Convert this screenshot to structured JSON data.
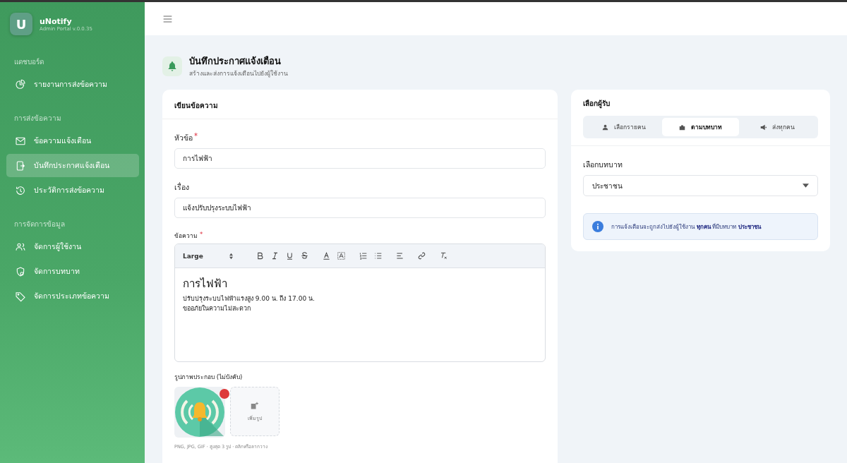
{
  "sidebar": {
    "app_name": "uNotify",
    "version": "Admin Portal v.0.0.35",
    "logo_letter": "U",
    "sections": [
      {
        "title": "แดชบอร์ด",
        "items": [
          {
            "label": "รายงานการส่งข้อความ",
            "selected": false
          }
        ]
      },
      {
        "title": "การส่งข้อความ",
        "items": [
          {
            "label": "ข้อความแจ้งเตือน",
            "selected": false
          },
          {
            "label": "บันทึกประกาศแจ้งเตือน",
            "selected": true
          },
          {
            "label": "ประวัติการส่งข้อความ",
            "selected": false
          }
        ]
      },
      {
        "title": "การจัดการข้อมูล",
        "items": [
          {
            "label": "จัดการผู้ใช้งาน",
            "selected": false
          },
          {
            "label": "จัดการบทบาท",
            "selected": false
          },
          {
            "label": "จัดการประเภทข้อความ",
            "selected": false
          }
        ]
      }
    ]
  },
  "page": {
    "title": "บันทึกประกาศแจ้งเตือน",
    "subtitle": "สร้างและส่งการแจ้งเตือนไปยังผู้ใช้งาน"
  },
  "compose": {
    "title": "เขียนข้อความ",
    "fields": [
      {
        "label": "หัวข้อ",
        "required_mark": "*",
        "value": "การไฟฟ้า"
      },
      {
        "label": "เรื่อง",
        "value": "แจ้งปรับปรุงระบบไฟฟ้า"
      }
    ],
    "message_label": "ข้อความ",
    "message_required_mark": "*",
    "editor": {
      "size": "Large",
      "heading": "การไฟฟ้า",
      "lines": [
        "ปรับปรุงระบบไฟฟ้าแรงสูง 9.00 น. ถึง 17.00 น.",
        "ขออภัยในความไม่สะดวก"
      ]
    },
    "images_label": "รูปภาพประกอบ (ไม่บังคับ)",
    "add_image": "เพิ่มรูป",
    "images_hint": "PNG, JPG, GIF · สูงสุด 3 รูป · คลิกหรือลากวาง"
  },
  "recipients": {
    "title": "เลือกผู้รับ",
    "tabs": [
      {
        "label": "เลือกรายคน",
        "selected": false
      },
      {
        "label": "ตามบทบาท",
        "selected": true
      },
      {
        "label": "ส่งทุกคน",
        "selected": false
      }
    ],
    "role_label": "เลือกบทบาท",
    "role_value": "ประชาชน",
    "info": "การแจ้งเตือนจะถูกส่งไปยังผู้ใช้งาน **ทุกคน** ที่มีบทบาท **ประชาชน**"
  }
}
